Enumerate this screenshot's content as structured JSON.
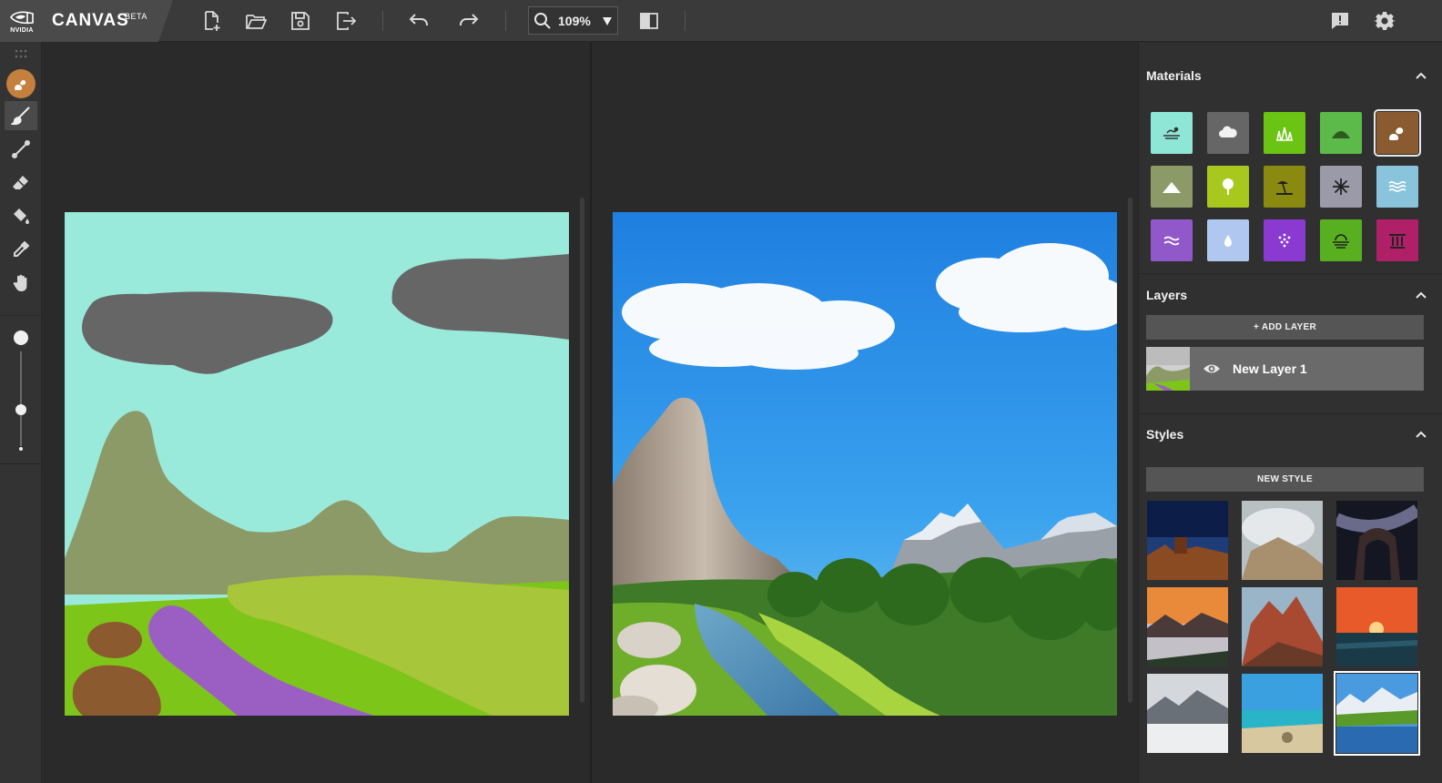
{
  "app": {
    "brand_word": "NVIDIA",
    "name": "CANVAS",
    "badge": "BETA"
  },
  "toolbar": {
    "buttons": [
      {
        "name": "new-file-button",
        "icon": "new-file-icon"
      },
      {
        "name": "open-file-button",
        "icon": "folder-open-icon"
      },
      {
        "name": "save-button",
        "icon": "save-icon"
      },
      {
        "name": "export-button",
        "icon": "export-icon"
      },
      {
        "name": "undo-button",
        "icon": "undo-icon"
      },
      {
        "name": "redo-button",
        "icon": "redo-icon"
      }
    ],
    "zoom_value": "109%",
    "compare_icon": "split-view-icon",
    "feedback_icon": "feedback-icon",
    "settings_icon": "gear-icon"
  },
  "left_tools": {
    "current_material_color": "#c4803c",
    "tools": [
      "brush-icon",
      "line-icon",
      "eraser-icon",
      "fill-bucket-icon",
      "eyedropper-icon",
      "hand-icon"
    ],
    "active_tool": "brush-icon",
    "brush_size_fraction": 0.3
  },
  "materials": {
    "title": "Materials",
    "tiles": [
      {
        "name": "sea",
        "color": "#8ee6d6"
      },
      {
        "name": "cloud",
        "color": "#666666"
      },
      {
        "name": "grass",
        "color": "#6bc414"
      },
      {
        "name": "hill",
        "color": "#5cba4a"
      },
      {
        "name": "rock",
        "color": "#8a5a30",
        "selected": true
      },
      {
        "name": "mountain",
        "color": "#8c9a68"
      },
      {
        "name": "tree",
        "color": "#a8c81e"
      },
      {
        "name": "beach",
        "color": "#8a8a10"
      },
      {
        "name": "snow",
        "color": "#9a9aa8"
      },
      {
        "name": "water",
        "color": "#8ac4dc"
      },
      {
        "name": "river",
        "color": "#9058c8"
      },
      {
        "name": "sky",
        "color": "#b0c8f0"
      },
      {
        "name": "flowers",
        "color": "#8a3ad0"
      },
      {
        "name": "fog",
        "color": "#58b020"
      },
      {
        "name": "structure",
        "color": "#b02068"
      }
    ]
  },
  "layers": {
    "title": "Layers",
    "add_label": "+ ADD LAYER",
    "items": [
      {
        "name": "New Layer 1",
        "visible": true
      }
    ]
  },
  "styles": {
    "title": "Styles",
    "new_label": "NEW STYLE",
    "thumbs": [
      {
        "name": "desert-night"
      },
      {
        "name": "cloudy-rocks"
      },
      {
        "name": "milky-way-arch"
      },
      {
        "name": "sunset-fog"
      },
      {
        "name": "red-peaks"
      },
      {
        "name": "ocean-sunset"
      },
      {
        "name": "misty-peaks"
      },
      {
        "name": "tropical-beach"
      },
      {
        "name": "alpine-lake",
        "selected": true
      }
    ]
  }
}
